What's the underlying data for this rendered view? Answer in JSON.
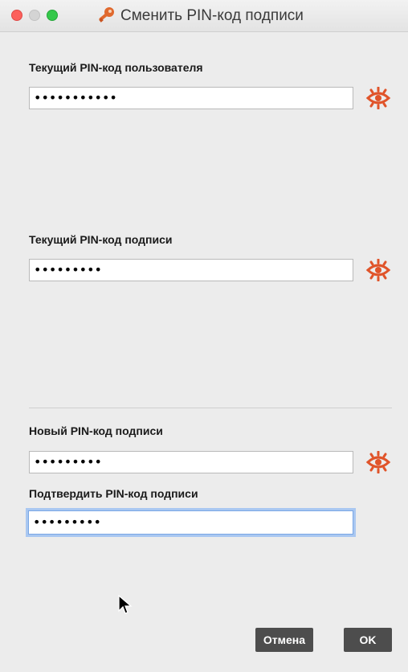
{
  "window": {
    "title": "Сменить PIN-код подписи",
    "title_icon": "key-icon",
    "traffic_lights": [
      "close",
      "minimize",
      "zoom"
    ]
  },
  "current_user_pin": {
    "label": "Текущий PIN-код пользователя",
    "value": "•••••••••••",
    "reveal_icon": "eye-icon"
  },
  "current_sign_pin": {
    "label": "Текущий PIN-код подписи",
    "value": "•••••••••",
    "reveal_icon": "eye-icon"
  },
  "new_sign_pin": {
    "label": "Новый PIN-код подписи",
    "value": "•••••••••",
    "reveal_icon": "eye-icon"
  },
  "confirm_sign_pin": {
    "label": "Подтвердить PIN-код подписи",
    "value": "•••••••••",
    "focused": true
  },
  "buttons": {
    "cancel": "Отмена",
    "ok": "OK"
  },
  "colors": {
    "accent_eye": "#e0542a",
    "button_bg": "#4d4d4d",
    "focus_ring": "#a9c7f1"
  }
}
